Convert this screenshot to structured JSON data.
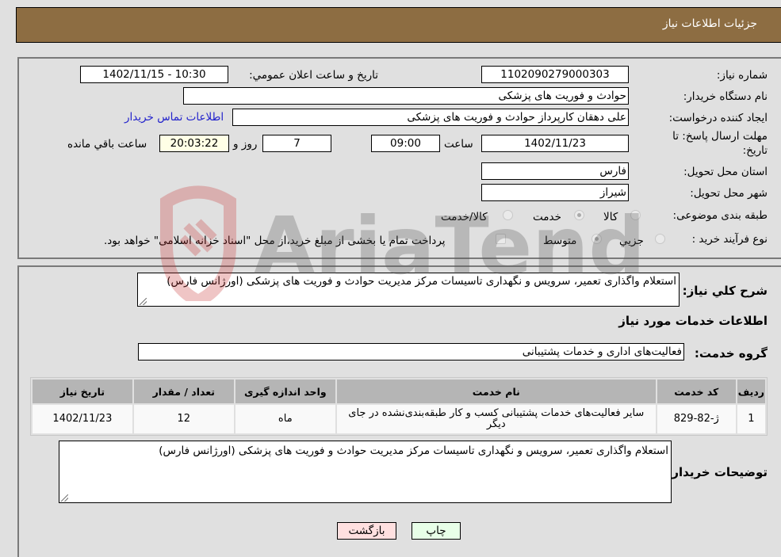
{
  "header": {
    "title": "جزئیات اطلاعات نیاز"
  },
  "details": {
    "need_number_label": "شماره نیاز:",
    "need_number": "1102090279000303",
    "announce_label": "تاریخ و ساعت اعلان عمومي:",
    "announce_value": "1402/11/15 - 10:30",
    "buyer_org_label": "نام دستگاه خریدار:",
    "buyer_org": "حوادث و فوریت های پزشکی",
    "creator_label": "ایجاد کننده درخواست:",
    "creator": "علی دهقان کارپرداز حوادث و فوریت های پزشکی",
    "contact_link": "اطلاعات تماس خریدار",
    "deadline_label_line1": "مهلت ارسال پاسخ: تا",
    "deadline_label_line2": "تاریخ:",
    "deadline_date": "1402/11/23",
    "time_label": "ساعت",
    "deadline_time": "09:00",
    "days": "7",
    "days_label": "روز و",
    "remaining_time": "20:03:22",
    "remaining_label": "ساعت باقي مانده",
    "province_label": "استان محل تحویل:",
    "province": "فارس",
    "city_label": "شهر محل تحویل:",
    "city": "شیراز",
    "category_label": "طبقه بندی موضوعی:",
    "category_options": [
      "کالا",
      "خدمت",
      "کالا/خدمت"
    ],
    "category_selected": "خدمت",
    "process_label": "نوع فرآیند خرید :",
    "process_options": [
      "جزیي",
      "متوسط"
    ],
    "process_selected": "متوسط",
    "treasury_note": "پرداخت تمام یا بخشی از مبلغ خرید،از محل \"اسناد خزانه اسلامی\" خواهد بود."
  },
  "summary": {
    "description_label": "شرح کلي نیاز:",
    "description": "استعلام واگذاری تعمیر، سرویس و نگهداری تاسیسات مرکز مدیریت حوادث و فوریت های پزشکی (اورژانس فارس)",
    "services_heading": "اطلاعات خدمات مورد نیاز",
    "service_group_label": "گروه خدمت:",
    "service_group": "فعالیت‌های اداری و خدمات پشتیبانی"
  },
  "table": {
    "headers": [
      "ردیف",
      "کد خدمت",
      "نام خدمت",
      "واحد اندازه گیری",
      "تعداد / مقدار",
      "تاریخ نیاز"
    ],
    "rows": [
      [
        "1",
        "ژ-82-829",
        "سایر فعالیت‌های خدمات پشتیبانی کسب و کار طبقه‌بندی‌نشده در جای دیگر",
        "ماه",
        "12",
        "1402/11/23"
      ]
    ]
  },
  "buyer_notes": {
    "label": "توضیحات خریدار:",
    "text": "استعلام واگذاری تعمیر، سرویس و نگهداری تاسیسات مرکز مدیریت حوادث و فوریت های پزشکی (اورژانس فارس)"
  },
  "buttons": {
    "print": "چاپ",
    "back": "بازگشت"
  },
  "watermark": {
    "text": "AriaTender.neT"
  },
  "colors": {
    "header_bg": "#8d6d42",
    "link": "#2222cc",
    "print_bg": "#e8ffe8",
    "back_bg": "#ffe0e0",
    "remaining_bg": "#ffffe6"
  }
}
